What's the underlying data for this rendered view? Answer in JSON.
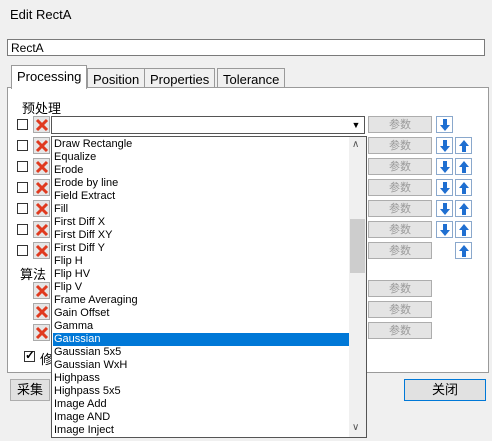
{
  "window": {
    "title": "Edit RectA"
  },
  "name_field": {
    "value": "RectA"
  },
  "tabs": [
    {
      "label": "Processing"
    },
    {
      "label": "Position"
    },
    {
      "label": "Properties"
    },
    {
      "label": "Tolerance"
    }
  ],
  "sections": {
    "preprocess": "预处理",
    "algorithm": "算法",
    "modify_label": "修"
  },
  "param_label": "参数",
  "combo": {
    "value": ""
  },
  "dropdown": {
    "items": [
      "Draw Rectangle",
      "Equalize",
      "Erode",
      "Erode by line",
      "Field Extract",
      "Fill",
      "First Diff X",
      "First Diff XY",
      "First Diff Y",
      "Flip H",
      "Flip HV",
      "Flip V",
      "Frame Averaging",
      "Gain Offset",
      "Gamma",
      "Gaussian",
      "Gaussian 5x5",
      "Gaussian WxH",
      "Highpass",
      "Highpass 5x5",
      "Image Add",
      "Image AND",
      "Image Inject"
    ],
    "selected": "Gaussian"
  },
  "buttons": {
    "capture": "采集",
    "close": "关闭"
  },
  "colors": {
    "selection": "#0078d7",
    "delete": "#e03a1f",
    "arrow": "#1f6fd1"
  }
}
